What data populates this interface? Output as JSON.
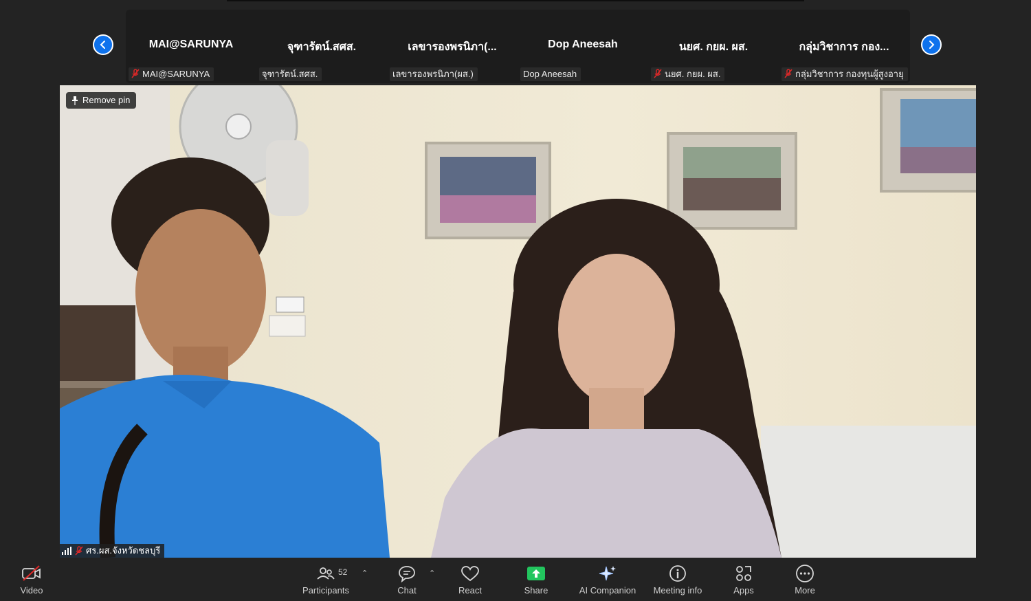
{
  "participants_strip": [
    {
      "display": "MAI@SARUNYA",
      "label": "MAI@SARUNYA",
      "muted": true
    },
    {
      "display": "จุฑารัตน์.สศส.",
      "label": "จุฑารัตน์.สศส.",
      "muted": false
    },
    {
      "display": "เลขารองพรนิภา(...",
      "label": "เลขารองพรนิภา(ผส.)",
      "muted": false
    },
    {
      "display": "Dop Aneesah",
      "label": "Dop Aneesah",
      "muted": false
    },
    {
      "display": "นยศ. กยผ. ผส.",
      "label": "นยศ. กยผ. ผส.",
      "muted": true
    },
    {
      "display": "กลุ่มวิชาการ กอง...",
      "label": "กลุ่มวิชาการ กองทุนผู้สูงอายุ",
      "muted": true
    }
  ],
  "main_video": {
    "pin_label": "Remove pin",
    "speaker_name": "ศร.ผส.จังหวัดชลบุรี"
  },
  "toolbar": {
    "video": "Video",
    "participants": "Participants",
    "participants_count": "52",
    "chat": "Chat",
    "react": "React",
    "share": "Share",
    "ai_companion": "AI Companion",
    "meeting_info": "Meeting info",
    "apps": "Apps",
    "more": "More"
  },
  "colors": {
    "accent": "#0e72ed",
    "share_green": "#22c55e",
    "muted_red": "#e02828"
  }
}
